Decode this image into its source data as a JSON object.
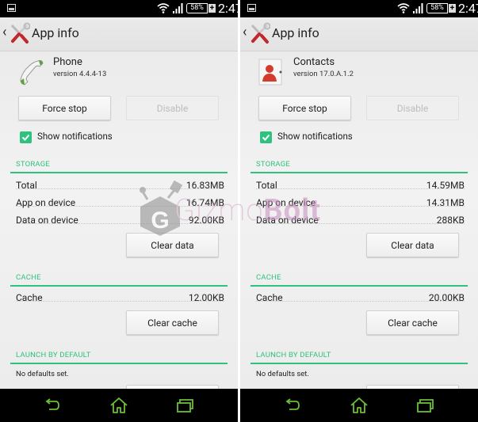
{
  "status_bar": {
    "battery_percent": "58%",
    "charging_label": "+",
    "time": "2:47",
    "icons": [
      "image-notification-icon",
      "wifi-icon",
      "signal-icon",
      "battery-icon",
      "charging-icon"
    ]
  },
  "screens": [
    {
      "action_bar": {
        "back_icon": "chevron-left-icon",
        "app_icon": "settings-tools-icon",
        "title": "App info"
      },
      "app": {
        "icon": "phone-handset-icon",
        "name": "Phone",
        "version": "version 4.4.4-13"
      },
      "buttons": {
        "force_stop": "Force stop",
        "disable": "Disable",
        "clear_data": "Clear data",
        "clear_cache": "Clear cache"
      },
      "show_notifications": {
        "label": "Show notifications",
        "checked": true
      },
      "storage": {
        "title": "STORAGE",
        "rows": [
          {
            "label": "Total",
            "value": "16.83MB"
          },
          {
            "label": "App on device",
            "value": "16.74MB"
          },
          {
            "label": "Data on device",
            "value": "92.00KB"
          }
        ]
      },
      "cache": {
        "title": "CACHE",
        "rows": [
          {
            "label": "Cache",
            "value": "12.00KB"
          }
        ]
      },
      "launch_by_default": {
        "title": "LAUNCH BY DEFAULT",
        "text": "No defaults set."
      }
    },
    {
      "action_bar": {
        "back_icon": "chevron-left-icon",
        "app_icon": "settings-tools-icon",
        "title": "App info"
      },
      "app": {
        "icon": "contacts-person-icon",
        "name": "Contacts",
        "version": "version 17.0.A.1.2"
      },
      "buttons": {
        "force_stop": "Force stop",
        "disable": "Disable",
        "clear_data": "Clear data",
        "clear_cache": "Clear cache"
      },
      "show_notifications": {
        "label": "Show notifications",
        "checked": true
      },
      "storage": {
        "title": "STORAGE",
        "rows": [
          {
            "label": "Total",
            "value": "14.59MB"
          },
          {
            "label": "App on device",
            "value": "14.31MB"
          },
          {
            "label": "Data on device",
            "value": "288KB"
          }
        ]
      },
      "cache": {
        "title": "CACHE",
        "rows": [
          {
            "label": "Cache",
            "value": "20.00KB"
          }
        ]
      },
      "launch_by_default": {
        "title": "LAUNCH BY DEFAULT",
        "text": "No defaults set."
      }
    }
  ],
  "nav_bar": {
    "icons": [
      "back-icon",
      "home-icon",
      "recent-apps-icon"
    ]
  },
  "watermark": {
    "part1": "Gizmo",
    "part2": "Bolt"
  },
  "colors": {
    "accent": "#2ec27e",
    "nav_icon": "#6abf3a",
    "tools_red": "#c0282a"
  }
}
